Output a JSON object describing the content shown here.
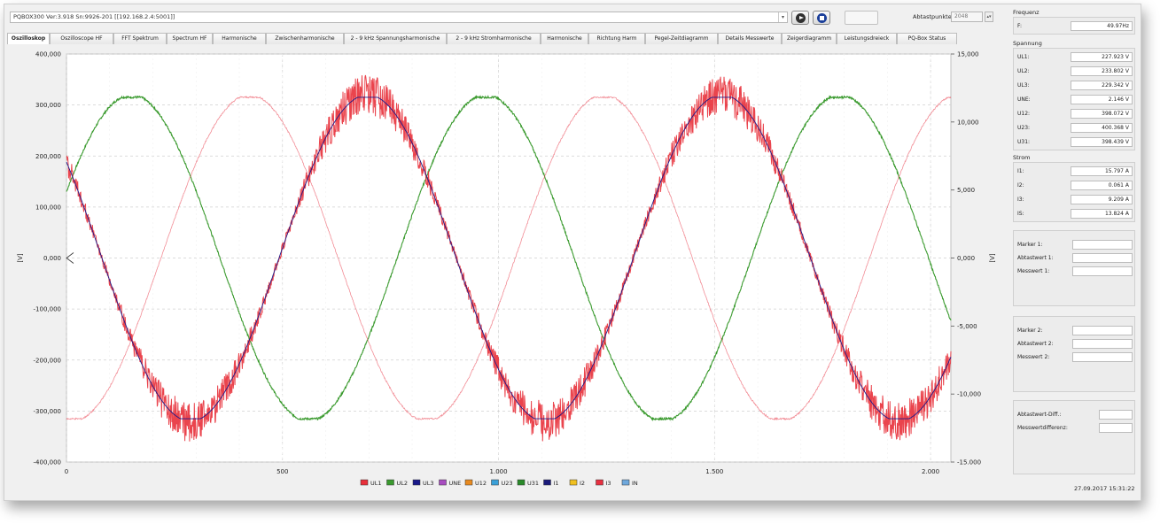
{
  "header": {
    "device": "PQBOX300 Ver:3.918 Sn:9926-201 [[192.168.2.4:5001]]",
    "sample_points_label": "Abtastpunkte:",
    "sample_points_value": "2048"
  },
  "tabs": [
    {
      "label": "Oszilloskop",
      "active": true
    },
    {
      "label": "Oszilloscope HF"
    },
    {
      "label": "FFT Spektrum"
    },
    {
      "label": "Spectrum HF"
    },
    {
      "label": "Harmonische"
    },
    {
      "label": "Zwischenharmonische"
    },
    {
      "label": "2 - 9 kHz Spannungsharmonische"
    },
    {
      "label": "2 - 9 kHz Stromharmonische"
    },
    {
      "label": "Harmonische"
    },
    {
      "label": "Richtung Harm"
    },
    {
      "label": "Pegel-Zeitdiagramm"
    },
    {
      "label": "Details Messwerte"
    },
    {
      "label": "Zeigerdiagramm"
    },
    {
      "label": "Leistungsdreieck"
    },
    {
      "label": "PQ-Box Status"
    }
  ],
  "chart_data": {
    "type": "line",
    "ylabel": "[V]",
    "y2label": "[V]",
    "xlim": [
      0,
      2047
    ],
    "ylim": [
      -400000,
      400000
    ],
    "y2lim": [
      -15000,
      15000
    ],
    "x_ticks": [
      "0",
      "500",
      "1.000",
      "1.500",
      "2.000"
    ],
    "x_tick_values": [
      0,
      500,
      1000,
      1500,
      2000
    ],
    "y_ticks": [
      "400,000",
      "300,000",
      "200,000",
      "100,000",
      "0,000",
      "-100,000",
      "-200,000",
      "-300,000",
      "-400,000"
    ],
    "y_tick_values": [
      400000,
      300000,
      200000,
      100000,
      0,
      -100000,
      -200000,
      -300000,
      -400000
    ],
    "y2_ticks": [
      "15,000",
      "10,000",
      "5,000",
      "0,000",
      "-5,000",
      "-10,000",
      "-15.000"
    ],
    "y2_tick_values": [
      15000,
      10000,
      5000,
      0,
      -5000,
      -10000,
      -15000
    ],
    "grid": true,
    "waveform": {
      "samples_per_period": 820,
      "amplitude_V": 320000,
      "clip_ratio": 0.985
    },
    "series": [
      {
        "name": "UL1",
        "color": "#e8303a",
        "phase_deg": 144,
        "noise_V": 45000
      },
      {
        "name": "UL2",
        "color": "#3a9a2e",
        "phase_deg": 24
      },
      {
        "name": "UL3",
        "color": "#1a1a8a",
        "phase_deg": 144
      },
      {
        "name": "UNE",
        "color": "#a84cc0"
      },
      {
        "name": "U12",
        "color": "#e88a20"
      },
      {
        "name": "U23",
        "color": "#3aa0d8"
      },
      {
        "name": "U31",
        "color": "#2a8a2a"
      },
      {
        "name": "I1",
        "color": "#1a1a7a"
      },
      {
        "name": "I2",
        "color": "#f0c020"
      },
      {
        "name": "I3",
        "color": "#e83040",
        "phase_deg": 264
      },
      {
        "name": "IN",
        "color": "#6fa8dc"
      }
    ]
  },
  "panel": {
    "freq_title": "Frequenz",
    "freq": {
      "label": "F:",
      "value": "49.97Hz"
    },
    "voltage_title": "Spannung",
    "voltages": [
      {
        "label": "UL1:",
        "value": "227.923 V"
      },
      {
        "label": "UL2:",
        "value": "233.802 V"
      },
      {
        "label": "UL3:",
        "value": "229.342 V"
      },
      {
        "label": "UNE:",
        "value": "2.146 V"
      },
      {
        "label": "U12:",
        "value": "398.072 V"
      },
      {
        "label": "U23:",
        "value": "400.368 V"
      },
      {
        "label": "U31:",
        "value": "398.439 V"
      }
    ],
    "current_title": "Strom",
    "currents": [
      {
        "label": "I1:",
        "value": "15.797 A"
      },
      {
        "label": "I2:",
        "value": "0.061 A"
      },
      {
        "label": "I3:",
        "value": "9.209 A"
      },
      {
        "label": "IS:",
        "value": "13.824 A"
      }
    ],
    "marker1": {
      "marker": "Marker 1:",
      "sample": "Abtastwert 1:",
      "value": "Messwert 1:"
    },
    "marker2": {
      "marker": "Marker 2:",
      "sample": "Abtastwert 2:",
      "value": "Messwert 2:"
    },
    "diff": {
      "sample": "Abtastwert-Diff.:",
      "value": "Messwertdifferenz:"
    },
    "timestamp": "27.09.2017 15:31:22"
  }
}
